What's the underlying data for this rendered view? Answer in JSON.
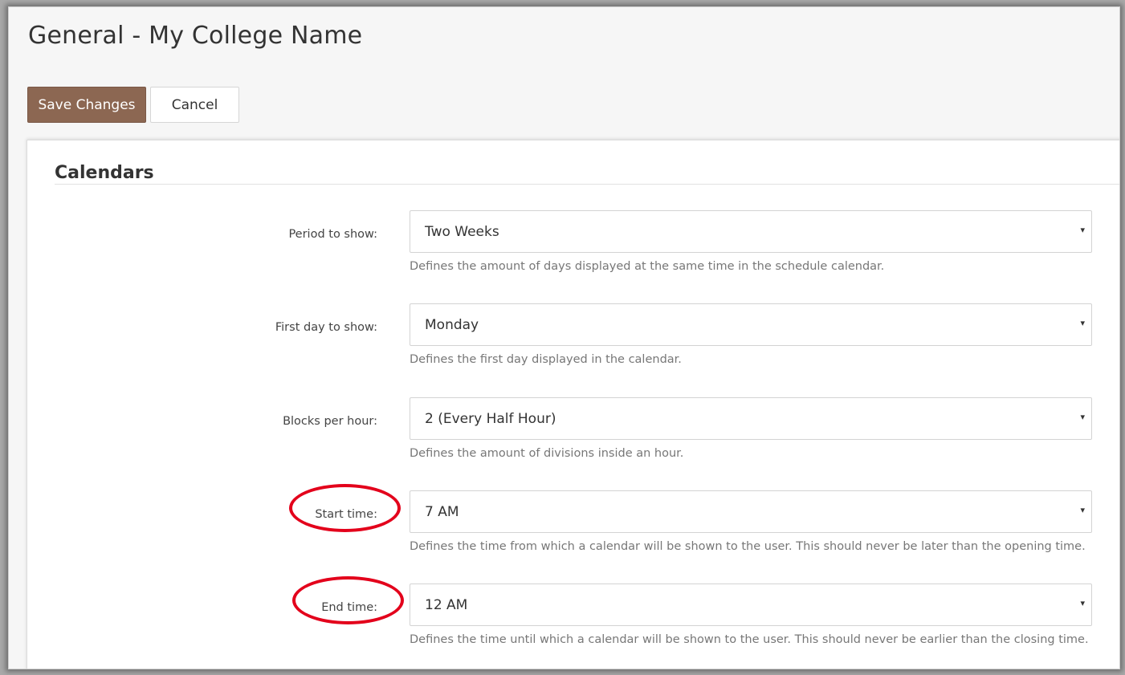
{
  "page": {
    "title": "General - My College Name"
  },
  "toolbar": {
    "save_label": "Save Changes",
    "cancel_label": "Cancel"
  },
  "section": {
    "title": "Calendars"
  },
  "fields": [
    {
      "label": "Period to show:",
      "value": "Two Weeks",
      "help": "Defines the amount of days displayed at the same time in the schedule calendar."
    },
    {
      "label": "First day to show:",
      "value": "Monday",
      "help": "Defines the first day displayed in the calendar."
    },
    {
      "label": "Blocks per hour:",
      "value": "2 (Every Half Hour)",
      "help": "Defines the amount of divisions inside an hour."
    },
    {
      "label": "Start time:",
      "value": "7 AM",
      "help": "Defines the time from which a calendar will be shown to the user. This should never be later than the opening time."
    },
    {
      "label": "End time:",
      "value": "12 AM",
      "help": "Defines the time until which a calendar will be shown to the user. This should never be earlier than the closing time."
    }
  ],
  "annotations": {
    "highlight_color": "#e3001b",
    "highlighted_fields": [
      "Start time:",
      "End time:"
    ]
  },
  "icons": {
    "select_caret": "▾"
  },
  "colors": {
    "primary_button": "#8c6752",
    "background": "#f6f6f6",
    "panel": "#ffffff"
  }
}
